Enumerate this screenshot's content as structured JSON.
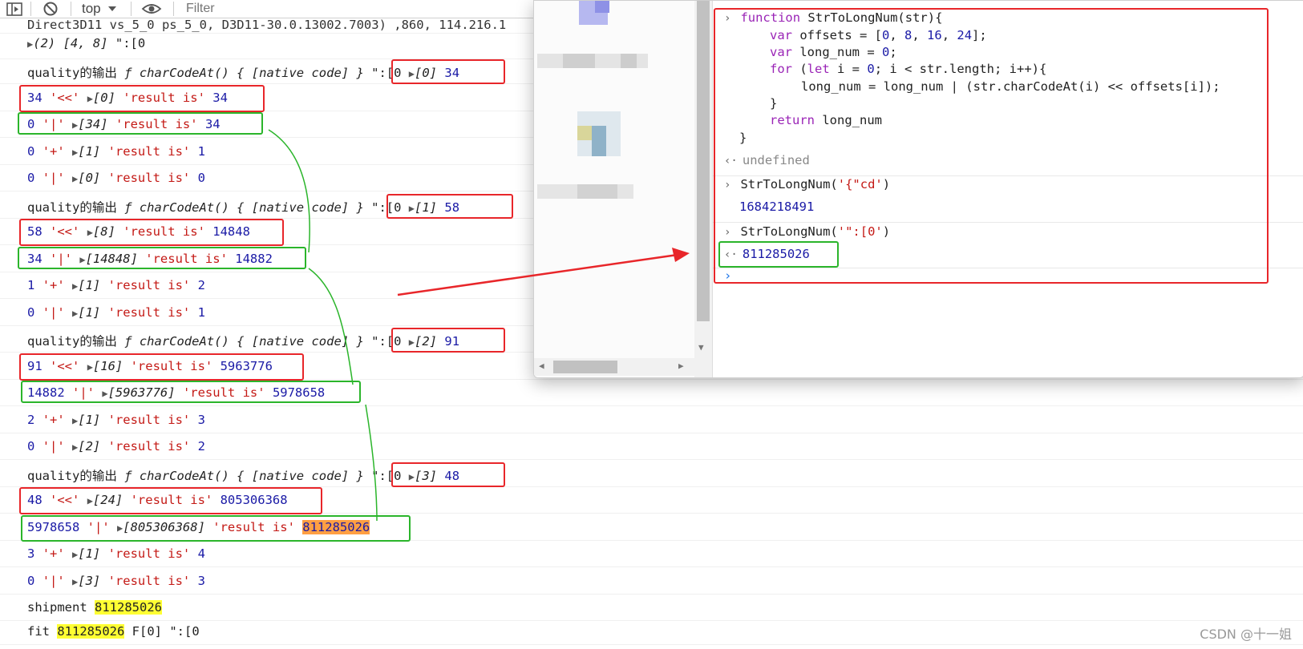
{
  "toolbar": {
    "context": "top",
    "filter_placeholder": "Filter"
  },
  "log": {
    "top_partial": "Direct3D11 vs_5_0 ps_5_0, D3D11-30.0.13002.7003) ,860, 114.216.1",
    "row1": {
      "prefix": "(2) ",
      "array": "[4, 8]",
      "tail": " \":[0"
    },
    "quality_prefix": "quality的输出 ",
    "quality_fn": "ƒ charCodeAt() { [native code] }",
    "quality_str": " \":[0 ",
    "groups": [
      {
        "q_index": "[0]",
        "q_val": "34",
        "shift": {
          "a": "34",
          "op": "'<<'",
          "arr": "[0]",
          "res_label": "'result is'",
          "res": "34"
        },
        "or": {
          "a": "0",
          "op": "'|'",
          "arr": "[34]",
          "res_label": "'result is'",
          "res": "34"
        },
        "plus": {
          "a": "0",
          "op": "'+'",
          "arr": "[1]",
          "res_label": "'result is'",
          "res": "1"
        },
        "or2": {
          "a": "0",
          "op": "'|'",
          "arr": "[0]",
          "res_label": "'result is'",
          "res": "0"
        }
      },
      {
        "q_index": "[1]",
        "q_val": "58",
        "shift": {
          "a": "58",
          "op": "'<<'",
          "arr": "[8]",
          "res_label": "'result is'",
          "res": "14848"
        },
        "or": {
          "a": "34",
          "op": "'|'",
          "arr": "[14848]",
          "res_label": "'result is'",
          "res": "14882"
        },
        "plus": {
          "a": "1",
          "op": "'+'",
          "arr": "[1]",
          "res_label": "'result is'",
          "res": "2"
        },
        "or2": {
          "a": "0",
          "op": "'|'",
          "arr": "[1]",
          "res_label": "'result is'",
          "res": "1"
        }
      },
      {
        "q_index": "[2]",
        "q_val": "91",
        "shift": {
          "a": "91",
          "op": "'<<'",
          "arr": "[16]",
          "res_label": "'result is'",
          "res": "5963776"
        },
        "or": {
          "a": "14882",
          "op": "'|'",
          "arr": "[5963776]",
          "res_label": "'result is'",
          "res": "5978658"
        },
        "plus": {
          "a": "2",
          "op": "'+'",
          "arr": "[1]",
          "res_label": "'result is'",
          "res": "3"
        },
        "or2": {
          "a": "0",
          "op": "'|'",
          "arr": "[2]",
          "res_label": "'result is'",
          "res": "2"
        }
      },
      {
        "q_index": "[3]",
        "q_val": "48",
        "shift": {
          "a": "48",
          "op": "'<<'",
          "arr": "[24]",
          "res_label": "'result is'",
          "res": "805306368"
        },
        "or": {
          "a": "5978658",
          "op": "'|'",
          "arr": "[805306368]",
          "res_label": "'result is'",
          "res": "811285026"
        },
        "plus": {
          "a": "3",
          "op": "'+'",
          "arr": "[1]",
          "res_label": "'result is'",
          "res": "4"
        },
        "or2": {
          "a": "0",
          "op": "'|'",
          "arr": "[3]",
          "res_label": "'result is'",
          "res": "3"
        }
      }
    ],
    "shipment": {
      "label": "shipment ",
      "value": "811285026"
    },
    "fit": {
      "label": "fit ",
      "value": "811285026",
      "tail": " F[0] \":[0"
    }
  },
  "devtools": {
    "code": {
      "l1_kw": "function",
      "l1_rest": " StrToLongNum(str){",
      "l2_kw": "var",
      "l2_a": " offsets = [",
      "l2_nums": [
        "0",
        "8",
        "16",
        "24"
      ],
      "l2_b": "];",
      "l3_kw": "var",
      "l3_a": " long_num = ",
      "l3_num": "0",
      "l3_b": ";",
      "l4_kw": "for",
      "l4_a": " (",
      "l4_kw2": "let",
      "l4_b": " i = ",
      "l4_num": "0",
      "l4_c": "; i < str.length; i++){",
      "l5": "long_num = long_num | (str.charCodeAt(i) << offsets[i]);",
      "l6": "}",
      "l7_kw": "return",
      "l7_rest": " long_num",
      "l8": "}"
    },
    "undefined_text": "undefined",
    "call1": {
      "fn": "StrToLongNum(",
      "arg": "'{\"cd'",
      "close": ")"
    },
    "result1": "1684218491",
    "call2": {
      "fn": "StrToLongNum(",
      "arg": "'\":[0'",
      "close": ")"
    },
    "result2": "811285026"
  },
  "watermark": "CSDN @十一姐"
}
